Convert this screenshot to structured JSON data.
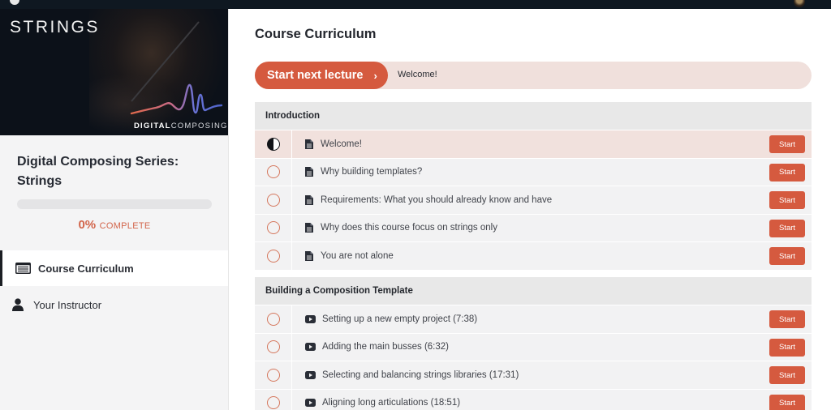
{
  "app": {
    "top_bar": {
      "logo_icon": "school-logo-icon",
      "avatar_icon": "user-avatar-icon"
    }
  },
  "sidebar": {
    "banner": {
      "title": "STRINGS",
      "brand_bold": "DIGITAL",
      "brand_light": "COMPOSING",
      "wave_colors": [
        "#e0694c",
        "#5a6fd6"
      ]
    },
    "course_title": "Digital Composing Series: Strings",
    "progress": {
      "percent": 0,
      "percent_label": "0%",
      "complete_label": "COMPLETE"
    },
    "nav": [
      {
        "label": "Course Curriculum",
        "icon": "curriculum-list-icon",
        "active": true
      },
      {
        "label": "Your Instructor",
        "icon": "user-icon",
        "active": false
      }
    ]
  },
  "main": {
    "title": "Course Curriculum",
    "next_lecture": {
      "button_label": "Start next lecture",
      "chevron": "›",
      "lecture_name": "Welcome!"
    },
    "sections": [
      {
        "title": "Introduction",
        "lectures": [
          {
            "title": "Welcome!",
            "type": "document",
            "status": "in-progress",
            "button": "Start"
          },
          {
            "title": "Why building templates?",
            "type": "document",
            "status": "not-started",
            "button": "Start"
          },
          {
            "title": "Requirements: What you should already know and have",
            "type": "document",
            "status": "not-started",
            "button": "Start"
          },
          {
            "title": "Why does this course focus on strings only",
            "type": "document",
            "status": "not-started",
            "button": "Start"
          },
          {
            "title": "You are not alone",
            "type": "document",
            "status": "not-started",
            "button": "Start"
          }
        ]
      },
      {
        "title": "Building a Composition Template",
        "lectures": [
          {
            "title": "Setting up a new empty project (7:38)",
            "type": "video",
            "status": "not-started",
            "button": "Start"
          },
          {
            "title": "Adding the main busses (6:32)",
            "type": "video",
            "status": "not-started",
            "button": "Start"
          },
          {
            "title": "Selecting and balancing strings libraries (17:31)",
            "type": "video",
            "status": "not-started",
            "button": "Start"
          },
          {
            "title": "Aligning long articulations (18:51)",
            "type": "video",
            "status": "not-started",
            "button": "Start"
          }
        ]
      }
    ]
  },
  "colors": {
    "accent": "#d55a3f",
    "accent_light": "#f0e0dc",
    "dark": "#0f1821",
    "sidebar_bg": "#f4f4f5"
  }
}
